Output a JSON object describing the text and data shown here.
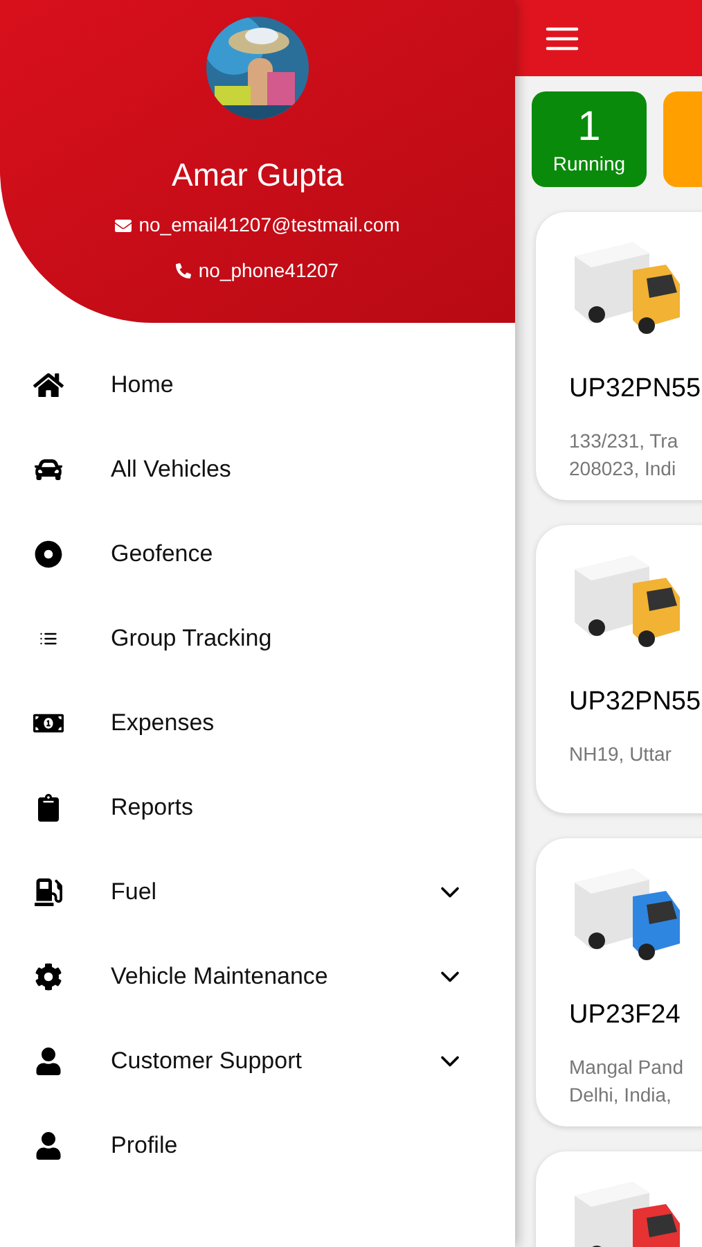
{
  "drawer": {
    "user": {
      "name": "Amar Gupta",
      "email": "no_email41207@testmail.com",
      "phone": "no_phone41207"
    },
    "menu": [
      {
        "label": "Home",
        "kind": "link"
      },
      {
        "label": "All Vehicles",
        "kind": "link"
      },
      {
        "label": "Geofence",
        "kind": "link"
      },
      {
        "label": "Group Tracking",
        "kind": "link"
      },
      {
        "label": "Expenses",
        "kind": "link"
      },
      {
        "label": "Reports",
        "kind": "link"
      },
      {
        "label": "Fuel",
        "kind": "group",
        "expanded": false
      },
      {
        "label": "Vehicle Maintenance",
        "kind": "group",
        "expanded": false
      },
      {
        "label": "Customer Support",
        "kind": "group",
        "expanded": false
      },
      {
        "label": "Profile",
        "kind": "link"
      }
    ]
  },
  "main": {
    "status_tiles": [
      {
        "count": "1",
        "label": "Running",
        "color": "#0a8a0a"
      },
      {
        "color": "#ffa000"
      }
    ],
    "vehicles": [
      {
        "number": "UP32PN55",
        "address": [
          "133/231, Tra",
          "208023, Indi"
        ],
        "color": "#f2b233"
      },
      {
        "number": "UP32PN55",
        "address": [
          "NH19, Uttar"
        ],
        "color": "#f2b233"
      },
      {
        "number": "UP23F24",
        "address": [
          "Mangal Pand",
          "Delhi, India,"
        ],
        "color": "#2f86e0"
      },
      {
        "color": "#e63232"
      }
    ]
  }
}
